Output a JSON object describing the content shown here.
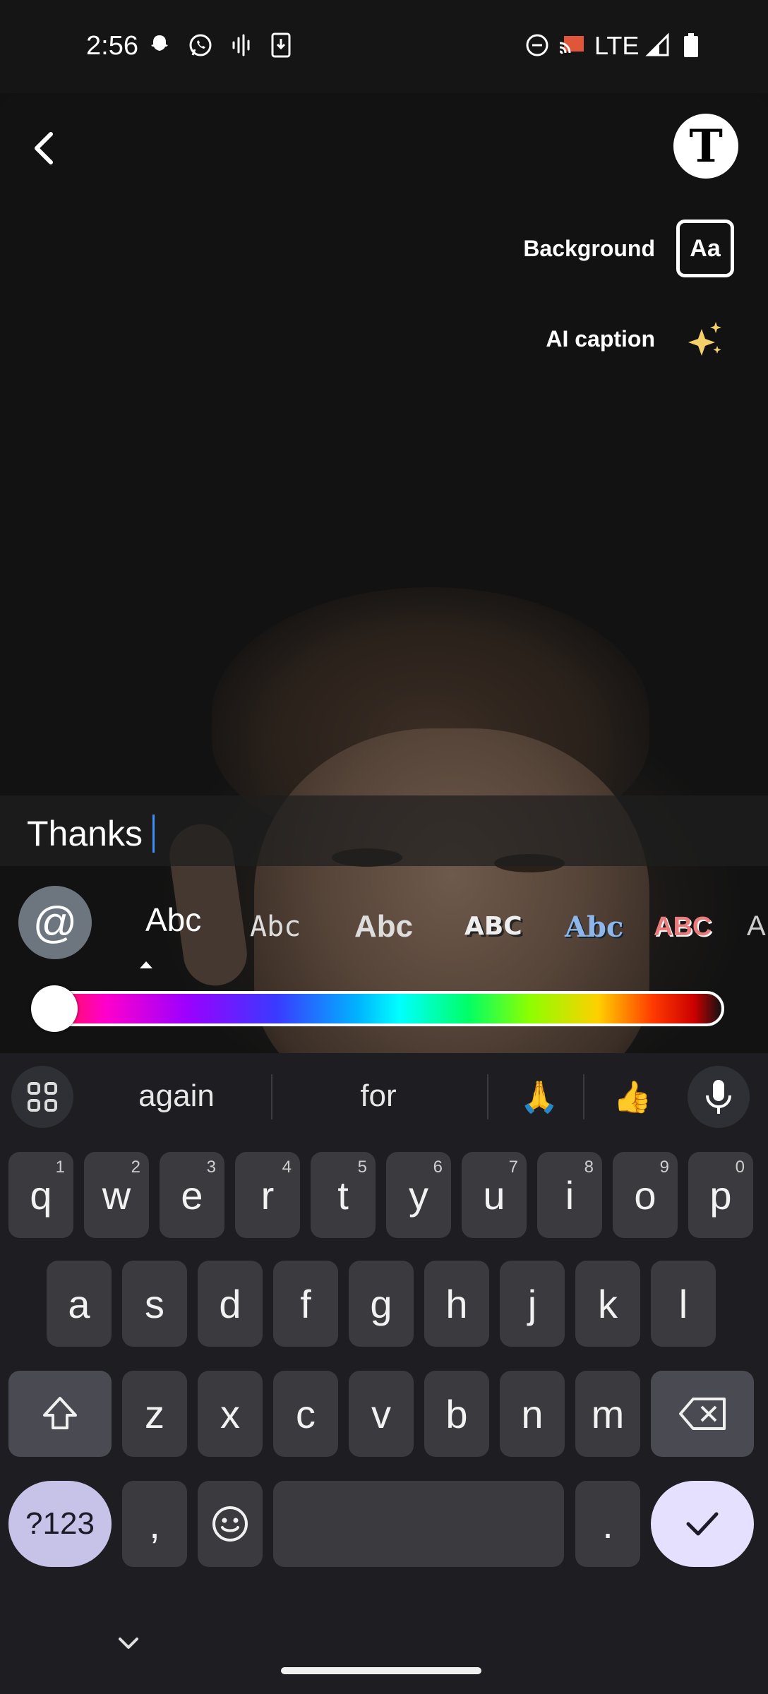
{
  "status_bar": {
    "time": "2:56",
    "network": "LTE",
    "left_icons": [
      "snapchat-icon",
      "whatsapp-icon",
      "audio-wave-icon",
      "download-icon"
    ],
    "right_icons": [
      "dnd-icon",
      "cast-icon",
      "signal-icon",
      "battery-icon"
    ]
  },
  "camera": {
    "background_label": "Background",
    "background_button_text": "Aa",
    "ai_caption_label": "AI caption",
    "text_tool_glyph": "T"
  },
  "caption": {
    "text": "Thanks"
  },
  "font_picker": {
    "mention_symbol": "@",
    "options": [
      "Abc",
      "Abc",
      "Abc",
      "ABC",
      "Abc",
      "ABC",
      "A"
    ]
  },
  "keyboard": {
    "suggestions": [
      "again",
      "for",
      "🙏",
      "👍"
    ],
    "row1": [
      {
        "key": "q",
        "hint": "1"
      },
      {
        "key": "w",
        "hint": "2"
      },
      {
        "key": "e",
        "hint": "3"
      },
      {
        "key": "r",
        "hint": "4"
      },
      {
        "key": "t",
        "hint": "5"
      },
      {
        "key": "y",
        "hint": "6"
      },
      {
        "key": "u",
        "hint": "7"
      },
      {
        "key": "i",
        "hint": "8"
      },
      {
        "key": "o",
        "hint": "9"
      },
      {
        "key": "p",
        "hint": "0"
      }
    ],
    "row2": [
      "a",
      "s",
      "d",
      "f",
      "g",
      "h",
      "j",
      "k",
      "l"
    ],
    "row3": [
      "z",
      "x",
      "c",
      "v",
      "b",
      "n",
      "m"
    ],
    "symbols_label": "?123",
    "comma": ",",
    "period": "."
  },
  "colors": {
    "accent_caret": "#3c8ef8",
    "enter_key": "#e6e0ff",
    "symbols_key": "#c7c3e8"
  }
}
